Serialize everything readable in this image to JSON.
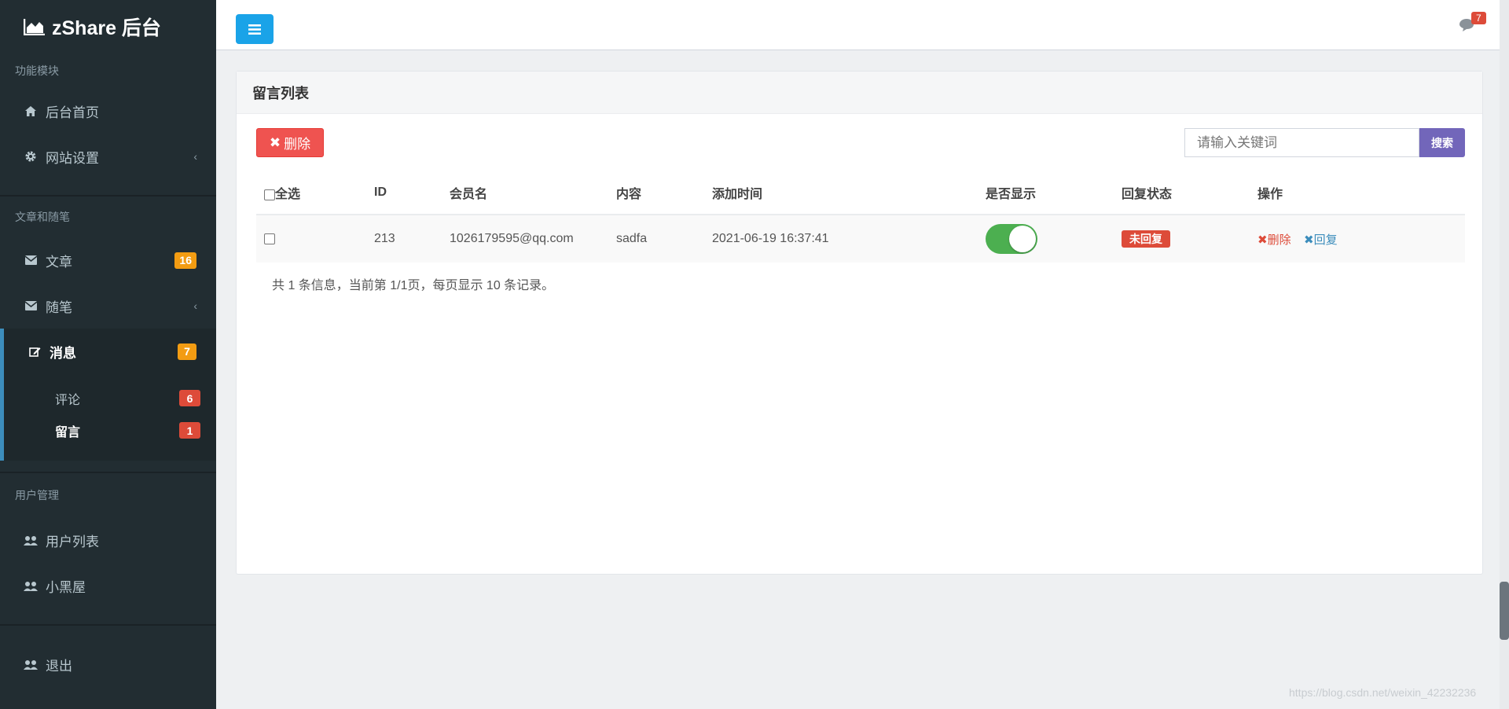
{
  "brand": {
    "name": "zShare 后台"
  },
  "sidebar": {
    "sections": [
      {
        "header": "功能模块"
      },
      {
        "header": "文章和随笔"
      },
      {
        "header": "用户管理"
      }
    ],
    "items": {
      "home": {
        "label": "后台首页",
        "icon": "home-icon"
      },
      "site_settings": {
        "label": "网站设置",
        "icon": "gear-icon"
      },
      "articles": {
        "label": "文章",
        "icon": "envelope-icon",
        "badge": "16"
      },
      "essays": {
        "label": "随笔",
        "icon": "envelope-icon"
      },
      "messages": {
        "label": "消息",
        "icon": "edit-icon",
        "badge": "7"
      },
      "comments": {
        "label": "评论",
        "badge": "6"
      },
      "guestbook": {
        "label": "留言",
        "badge": "1"
      },
      "user_list": {
        "label": "用户列表",
        "icon": "users-icon"
      },
      "blackroom": {
        "label": "小黑屋",
        "icon": "users-icon"
      },
      "logout": {
        "label": "退出",
        "icon": "users-icon"
      }
    }
  },
  "topbar": {
    "notification_count": "7",
    "icon": "comment-icon"
  },
  "panel": {
    "title": "留言列表",
    "delete_button": "删除",
    "search_placeholder": "请输入关键词",
    "search_button": "搜索",
    "columns": {
      "select_all": "全选",
      "id": "ID",
      "member": "会员名",
      "content": "内容",
      "time": "添加时间",
      "visible": "是否显示",
      "reply_status": "回复状态",
      "actions": "操作"
    },
    "rows": [
      {
        "id": "213",
        "member": "1026179595@qq.com",
        "content": "sadfa",
        "time": "2021-06-19 16:37:41",
        "visible": true,
        "reply_status": "未回复",
        "action_delete": "删除",
        "action_reply": "回复"
      }
    ],
    "pagination": "共 1 条信息，当前第 1/1页，每页显示 10 条记录。"
  },
  "watermark": "https://blog.csdn.net/weixin_42232236",
  "colors": {
    "sidebar_bg": "#222d32",
    "toggle_btn": "#1aa3e8",
    "delete": "#ef5350",
    "search": "#7266ba",
    "switch_on": "#4caf50"
  }
}
